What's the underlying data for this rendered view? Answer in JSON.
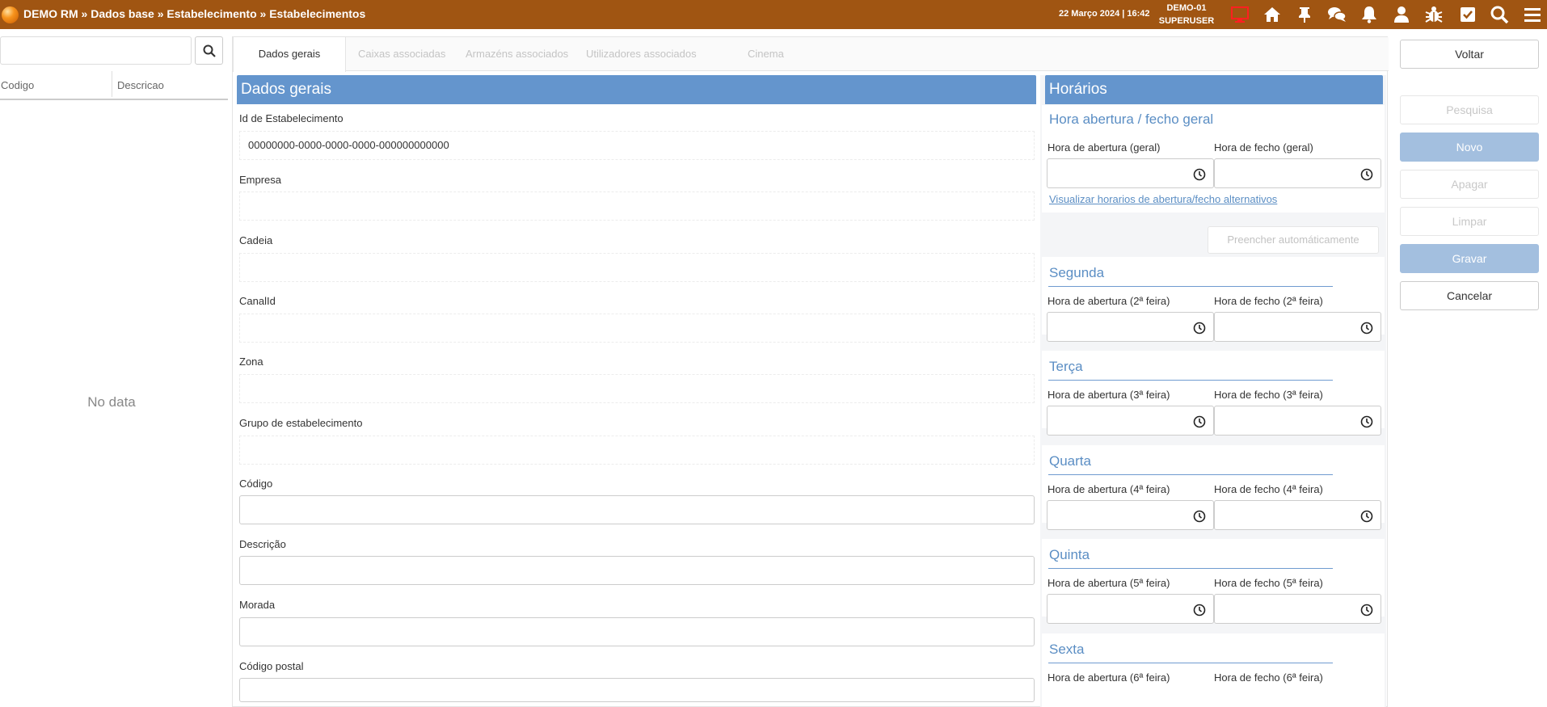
{
  "topbar": {
    "breadcrumb": "DEMO RM » Dados base » Estabelecimento » Estabelecimentos",
    "datetime": "22 Março 2024 | 16:42",
    "instance": "DEMO-01",
    "role": "SUPERUSER",
    "bg_color": "#a05512",
    "icons": [
      "monitor-icon",
      "home-icon",
      "pin-icon",
      "chat-icon",
      "bell-icon",
      "user-icon",
      "bug-icon",
      "checkbox-icon",
      "search-icon",
      "menu-icon"
    ]
  },
  "list": {
    "search_placeholder": "",
    "columns": [
      "Codigo",
      "Descricao"
    ],
    "empty_text": "No data"
  },
  "tabs": [
    "Dados gerais",
    "Caixas associadas",
    "Armazéns associados",
    "Utilizadores associados",
    "Cinema"
  ],
  "general": {
    "title": "Dados gerais",
    "fields": {
      "id_label": "Id de Estabelecimento",
      "id_value": "00000000-0000-0000-0000-000000000000",
      "empresa_label": "Empresa",
      "cadeia_label": "Cadeia",
      "canal_label": "CanalId",
      "zona_label": "Zona",
      "grupo_label": "Grupo de estabelecimento",
      "codigo_label": "Código",
      "descricao_label": "Descrição",
      "morada_label": "Morada",
      "codpostal_label": "Código postal"
    }
  },
  "schedule": {
    "title": "Horários",
    "general_section": "Hora abertura / fecho geral",
    "general_open": "Hora de abertura (geral)",
    "general_close": "Hora de fecho (geral)",
    "alt_link": "Visualizar horarios de abertura/fecho alternativos",
    "autofill": "Preencher automáticamente",
    "days": [
      {
        "name": "Segunda",
        "open": "Hora de abertura (2ª feira)",
        "close": "Hora de fecho (2ª feira)"
      },
      {
        "name": "Terça",
        "open": "Hora de abertura (3ª feira)",
        "close": "Hora de fecho (3ª feira)"
      },
      {
        "name": "Quarta",
        "open": "Hora de abertura (4ª feira)",
        "close": "Hora de fecho (4ª feira)"
      },
      {
        "name": "Quinta",
        "open": "Hora de abertura (5ª feira)",
        "close": "Hora de fecho (5ª feira)"
      },
      {
        "name": "Sexta",
        "open": "Hora de abertura (6ª feira)",
        "close": "Hora de fecho (6ª feira)"
      }
    ]
  },
  "actions": {
    "voltar": "Voltar",
    "pesquisa": "Pesquisa",
    "novo": "Novo",
    "apagar": "Apagar",
    "limpar": "Limpar",
    "gravar": "Gravar",
    "cancelar": "Cancelar"
  },
  "colors": {
    "header_blue": "#6495cd",
    "section_blue": "#5b8ec4",
    "button_disabled_blue": "#a3bfdf"
  }
}
